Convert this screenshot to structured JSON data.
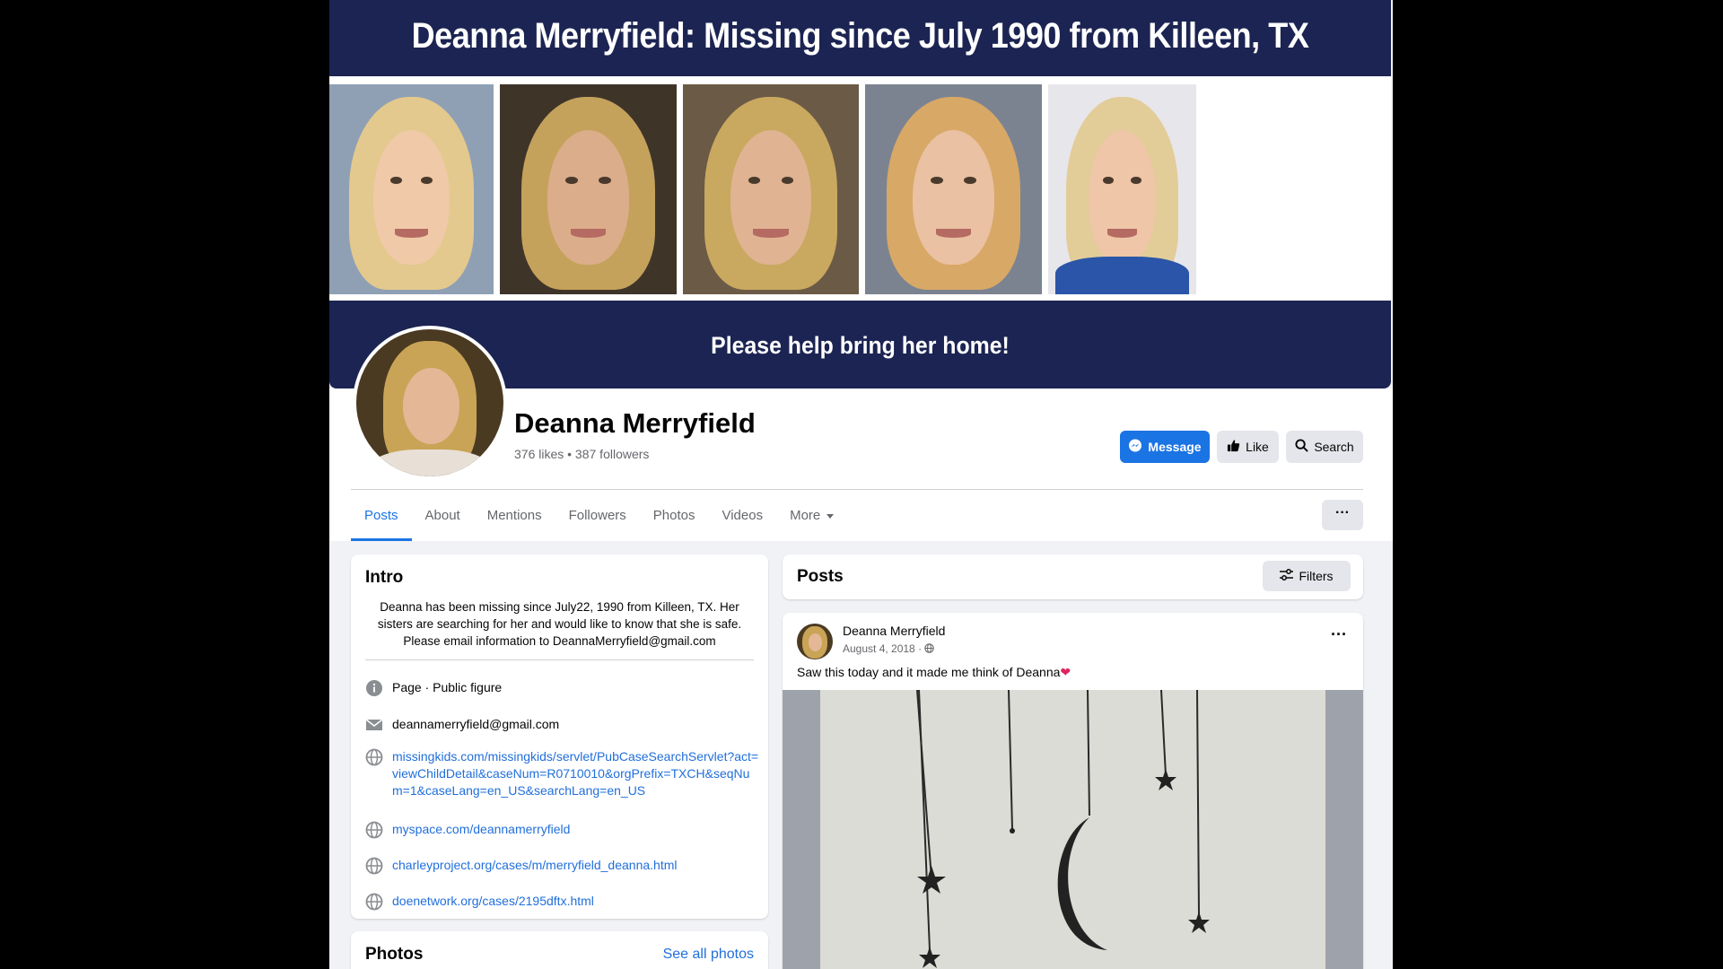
{
  "cover": {
    "title": "Deanna Merryfield:  Missing since July 1990 from Killeen, TX",
    "tagline": "Please help bring her home!"
  },
  "profile": {
    "name": "Deanna Merryfield",
    "stats": "376 likes • 387 followers"
  },
  "actions": {
    "message": "Message",
    "like": "Like",
    "search": "Search",
    "more_options": "···"
  },
  "tabs": [
    "Posts",
    "About",
    "Mentions",
    "Followers",
    "Photos",
    "Videos",
    "More"
  ],
  "intro": {
    "title": "Intro",
    "bio": "Deanna has been missing since July22, 1990 from Killeen, TX. Her sisters are searching for her and would like to know that she is safe. Please email information to DeannaMerryfield@gmail.com",
    "category": "Page · Public figure",
    "email": "deannamerryfield@gmail.com",
    "links": [
      "missingkids.com/missingkids/servlet/PubCaseSearchServlet?act=viewChildDetail&caseNum=R0710010&orgPrefix=TXCH&seqNum=1&caseLang=en_US&searchLang=en_US",
      "myspace.com/deannamerryfield",
      "charleyproject.org/cases/m/merryfield_deanna.html",
      "doenetwork.org/cases/2195dftx.html"
    ]
  },
  "photos": {
    "title": "Photos",
    "see_all": "See all photos"
  },
  "posts": {
    "title": "Posts",
    "filters": "Filters",
    "items": [
      {
        "author": "Deanna Merryfield",
        "date": "August 4, 2018 · ",
        "text": "Saw this today and it made me think of Deanna",
        "emoji": "❤"
      }
    ]
  },
  "icons": {
    "info": "info-icon",
    "email": "envelope-icon",
    "website": "globe-icon",
    "messenger": "messenger-icon",
    "like": "thumbs-up-icon",
    "search": "search-icon",
    "filters": "sliders-icon",
    "privacy": "globe-icon"
  },
  "colors": {
    "accent": "#1b74e4",
    "cover_band": "#1b2452",
    "link": "#216fdb"
  }
}
